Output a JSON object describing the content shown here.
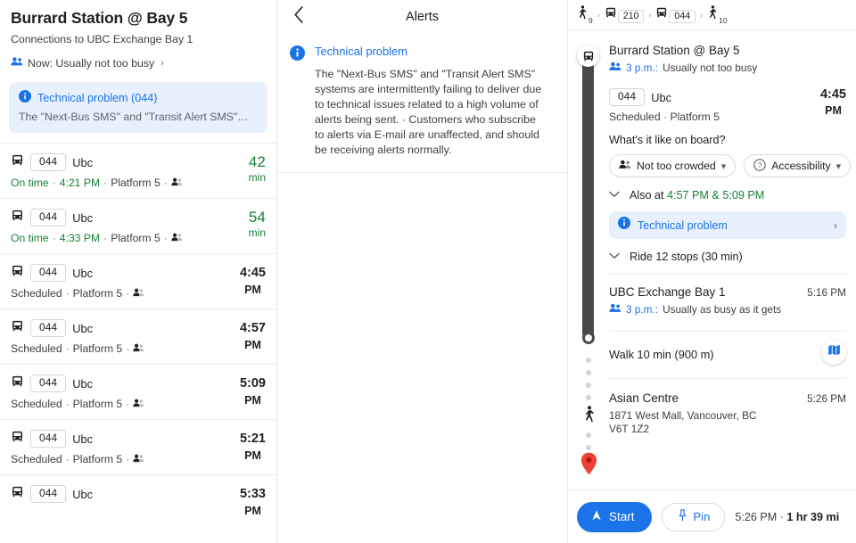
{
  "departures_panel": {
    "title": "Burrard Station @ Bay 5",
    "subtitle": "Connections to UBC Exchange Bay 1",
    "busy_status": "Now: Usually not too busy",
    "busy_chevron": "›",
    "alert_card": {
      "icon": "info-icon",
      "title": "Technical problem (044)",
      "body": "The \"Next-Bus SMS\" and \"Transit Alert SMS\"…"
    },
    "rows": [
      {
        "route": "044",
        "destination": "Ubc",
        "status": "On time",
        "status_type": "ontime",
        "time": "4:21 PM",
        "platform": "Platform 5",
        "occupancy_icon": "occupancy-icon",
        "right_primary": "42",
        "right_secondary": "min",
        "right_type": "minutes"
      },
      {
        "route": "044",
        "destination": "Ubc",
        "status": "On time",
        "status_type": "ontime",
        "time": "4:33 PM",
        "platform": "Platform 5",
        "occupancy_icon": "occupancy-icon",
        "right_primary": "54",
        "right_secondary": "min",
        "right_type": "minutes"
      },
      {
        "route": "044",
        "destination": "Ubc",
        "status": "Scheduled",
        "status_type": "scheduled",
        "time": "",
        "platform": "Platform 5",
        "occupancy_icon": "occupancy-icon",
        "right_primary": "4:45",
        "right_secondary": "PM",
        "right_type": "clock"
      },
      {
        "route": "044",
        "destination": "Ubc",
        "status": "Scheduled",
        "status_type": "scheduled",
        "time": "",
        "platform": "Platform 5",
        "occupancy_icon": "occupancy-icon",
        "right_primary": "4:57",
        "right_secondary": "PM",
        "right_type": "clock"
      },
      {
        "route": "044",
        "destination": "Ubc",
        "status": "Scheduled",
        "status_type": "scheduled",
        "time": "",
        "platform": "Platform 5",
        "occupancy_icon": "occupancy-icon",
        "right_primary": "5:09",
        "right_secondary": "PM",
        "right_type": "clock"
      },
      {
        "route": "044",
        "destination": "Ubc",
        "status": "Scheduled",
        "status_type": "scheduled",
        "time": "",
        "platform": "Platform 5",
        "occupancy_icon": "occupancy-icon",
        "right_primary": "5:21",
        "right_secondary": "PM",
        "right_type": "clock"
      },
      {
        "route": "044",
        "destination": "Ubc",
        "status": "",
        "status_type": "scheduled",
        "time": "",
        "platform": "",
        "occupancy_icon": "occupancy-icon",
        "right_primary": "5:33",
        "right_secondary": "PM",
        "right_type": "clock"
      }
    ]
  },
  "alerts_panel": {
    "back_icon": "chevron-left-icon",
    "title": "Alerts",
    "alert": {
      "icon": "info-icon",
      "heading": "Technical problem",
      "body": "The \"Next-Bus SMS\" and \"Transit Alert SMS\" systems are intermittently failing to deliver due to technical issues related to a high volume of alerts being sent. · Customers who subscribe to alerts via E-mail are unaffected, and should be receiving alerts normally."
    }
  },
  "trip_panel": {
    "breadcrumb": [
      {
        "type": "walk",
        "icon": "walk-icon",
        "value": "9"
      },
      {
        "type": "arrow",
        "glyph": "›"
      },
      {
        "type": "bus",
        "icon": "bus-icon",
        "value": "210"
      },
      {
        "type": "arrow",
        "glyph": "›"
      },
      {
        "type": "bus",
        "icon": "bus-icon",
        "value": "044"
      },
      {
        "type": "arrow",
        "glyph": "›"
      },
      {
        "type": "walk",
        "icon": "walk-icon",
        "value": "10"
      }
    ],
    "origin": {
      "icon": "bus-icon",
      "name": "Burrard Station @ Bay 5",
      "busy_time": "3 p.m.:",
      "busy_text": "Usually not too busy"
    },
    "leg": {
      "route": "044",
      "destination": "Ubc",
      "time": "4:45",
      "ampm": "PM",
      "status": "Scheduled",
      "platform": "Platform 5",
      "onboard_question": "What's it like on board?",
      "chips": [
        {
          "icon": "occupancy-icon",
          "label": "Not too crowded",
          "caret": "▾"
        },
        {
          "icon": "accessibility-icon",
          "label": "Accessibility",
          "caret": "▾"
        }
      ],
      "also_at_prefix": "Also at",
      "also_at_times": "4:57 PM & 5:09 PM",
      "alert_chip": {
        "icon": "info-icon",
        "label": "Technical problem",
        "chevron": "›"
      },
      "ride_stops": "Ride 12 stops (30 min)"
    },
    "transfer": {
      "name": "UBC Exchange Bay 1",
      "time": "5:16 PM",
      "busy_time": "3 p.m.:",
      "busy_text": "Usually as busy as it gets"
    },
    "walk": {
      "icon": "walk-icon",
      "label": "Walk 10 min (900 m)",
      "map_icon": "map-icon"
    },
    "destination": {
      "icon": "map-pin-icon",
      "name": "Asian Centre",
      "time": "5:26 PM",
      "address_line1": "1871 West Mall, Vancouver, BC",
      "address_line2": "V6T 1Z2"
    },
    "actions": {
      "start_label": "Start",
      "start_icon": "navigation-arrow-icon",
      "pin_label": "Pin",
      "pin_icon": "pin-icon",
      "eta_prefix": "5:26 PM · ",
      "eta_duration": "1 hr 39 mi"
    }
  },
  "colors": {
    "brand_blue": "#1a73e8",
    "alert_bg": "#e8f0fe",
    "ontime_green": "#188038",
    "pin_red": "#ea4335",
    "timeline_gray": "#4a4a4a"
  }
}
